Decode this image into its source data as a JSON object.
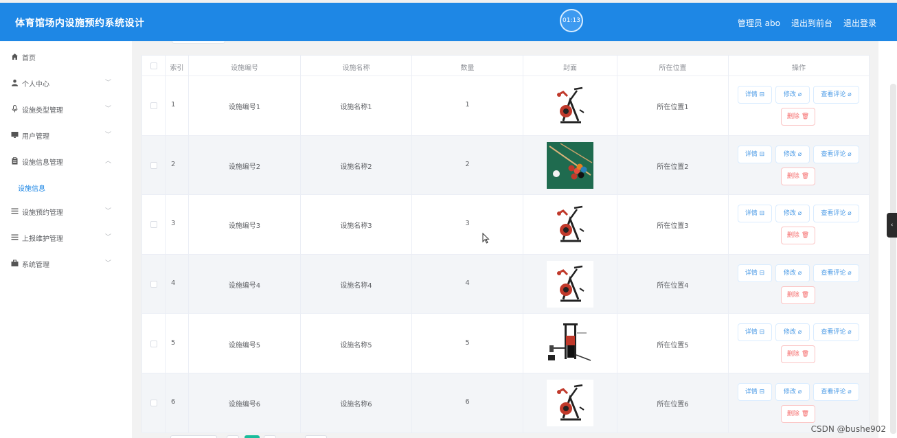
{
  "header": {
    "app_title": "体育馆场内设施预约系统设计",
    "clock": "01:13",
    "admin_label": "管理员 abo",
    "back_to_front": "退出到前台",
    "logout": "退出登录"
  },
  "sidebar": {
    "items": [
      {
        "label": "首页",
        "icon": "home-icon"
      },
      {
        "label": "个人中心",
        "icon": "user-icon"
      },
      {
        "label": "设施类型管理",
        "icon": "mic-icon"
      },
      {
        "label": "用户管理",
        "icon": "monitor-icon"
      },
      {
        "label": "设施信息管理",
        "icon": "clipboard-icon"
      },
      {
        "label": "设施预约管理",
        "icon": "list-icon"
      },
      {
        "label": "上报维护管理",
        "icon": "list-icon"
      },
      {
        "label": "系统管理",
        "icon": "briefcase-icon"
      }
    ],
    "active_sub": "设施信息"
  },
  "table": {
    "headers": [
      "索引",
      "设施编号",
      "设施名称",
      "数量",
      "封面",
      "所在位置",
      "操作"
    ],
    "rows": [
      {
        "index": "1",
        "code": "设施编号1",
        "name": "设施名称1",
        "qty": "1",
        "cover": "exercise-bike",
        "loc": "所在位置1"
      },
      {
        "index": "2",
        "code": "设施编号2",
        "name": "设施名称2",
        "qty": "2",
        "cover": "billiards",
        "loc": "所在位置2"
      },
      {
        "index": "3",
        "code": "设施编号3",
        "name": "设施名称3",
        "qty": "3",
        "cover": "exercise-bike",
        "loc": "所在位置3"
      },
      {
        "index": "4",
        "code": "设施编号4",
        "name": "设施名称4",
        "qty": "4",
        "cover": "exercise-bike",
        "loc": "所在位置4"
      },
      {
        "index": "5",
        "code": "设施编号5",
        "name": "设施名称5",
        "qty": "5",
        "cover": "home-gym",
        "loc": "所在位置5"
      },
      {
        "index": "6",
        "code": "设施编号6",
        "name": "设施名称6",
        "qty": "6",
        "cover": "exercise-bike",
        "loc": "所在位置6"
      }
    ],
    "actions": {
      "detail": "详情 ⊟",
      "edit": "修改 ⌀",
      "review": "查看评论 ⌀",
      "delete": "删除 🗑"
    }
  },
  "watermark": "CSDN @bushe902",
  "colors": {
    "brand": "#1e87e5",
    "danger": "#f56c6c",
    "row_alt": "#f3f5f8"
  }
}
